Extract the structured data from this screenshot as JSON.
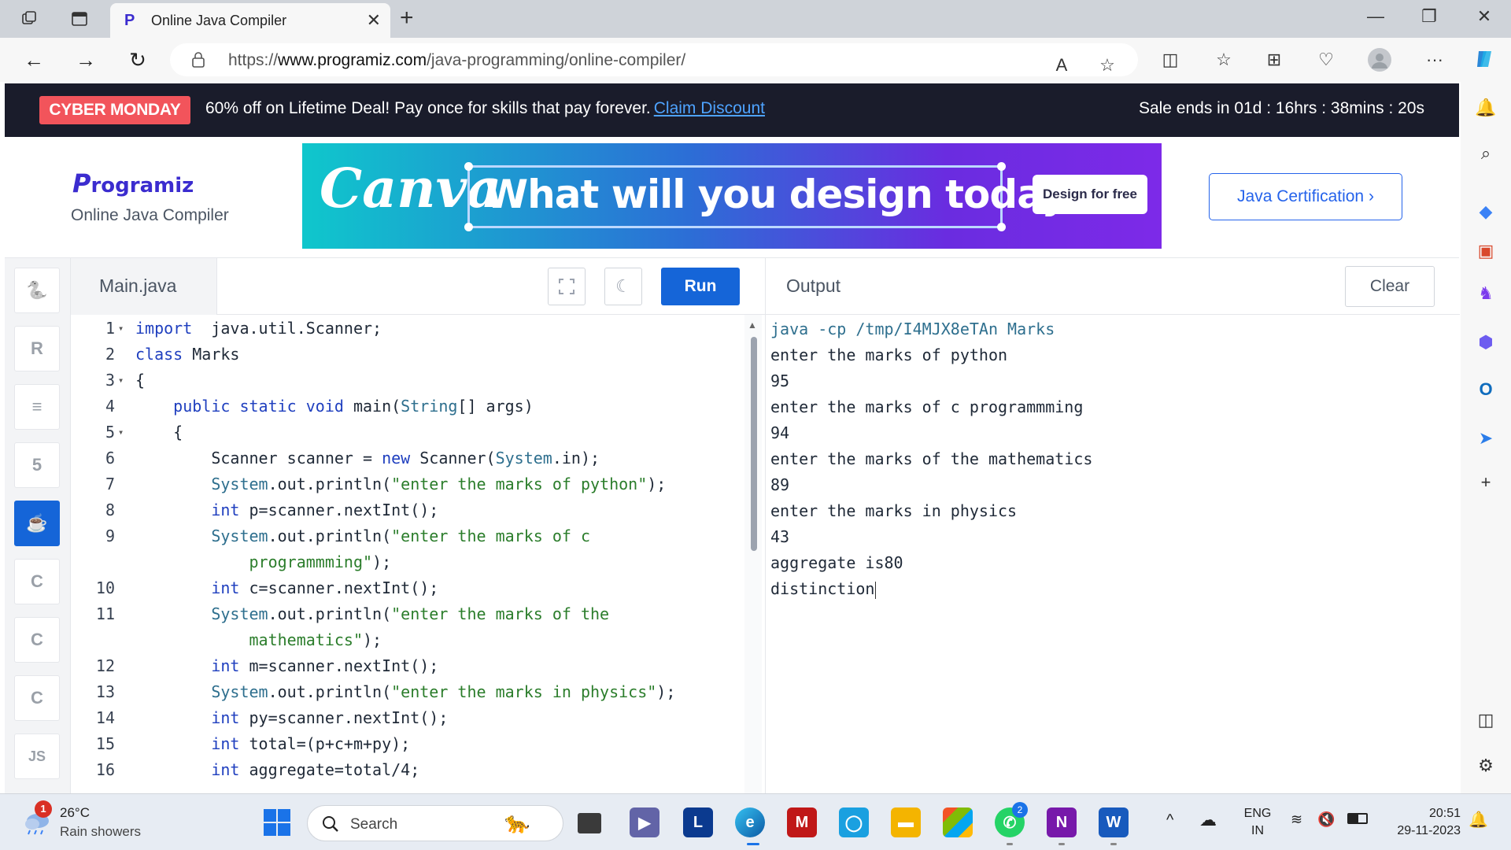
{
  "browser": {
    "tab_title": "Online Java Compiler",
    "url_prefix": "https://",
    "url_domain": "www.programiz.com",
    "url_path": "/java-programming/online-compiler/"
  },
  "promo": {
    "badge": "CYBER MONDAY",
    "text": "60% off on Lifetime Deal! Pay once for skills that pay forever.",
    "link": "Claim Discount",
    "timer": "Sale ends in 01d : 16hrs : 38mins : 20s"
  },
  "header": {
    "logo": "rogramiz",
    "logo_initial": "P",
    "subtitle": "Online Java Compiler",
    "ad_brand": "Canva",
    "ad_headline": "What will you design today?",
    "ad_cta": "Design for free",
    "cert_button": "Java Certification ›"
  },
  "languages": [
    {
      "name": "python",
      "glyph": "🐍"
    },
    {
      "name": "r",
      "glyph": "R"
    },
    {
      "name": "sql",
      "glyph": "≡"
    },
    {
      "name": "html",
      "glyph": "5"
    },
    {
      "name": "java",
      "glyph": "☕"
    },
    {
      "name": "c",
      "glyph": "C"
    },
    {
      "name": "cpp",
      "glyph": "C"
    },
    {
      "name": "csharp",
      "glyph": "C"
    },
    {
      "name": "js",
      "glyph": "JS"
    }
  ],
  "editor": {
    "file_name": "Main.java",
    "run_label": "Run",
    "lines": [
      {
        "n": "1",
        "fold": true,
        "tokens": [
          [
            "kw",
            "import"
          ],
          [
            "",
            "  java.util.Scanner;"
          ]
        ]
      },
      {
        "n": "2",
        "fold": false,
        "tokens": [
          [
            "kw",
            "class"
          ],
          [
            "",
            " Marks"
          ]
        ]
      },
      {
        "n": "3",
        "fold": true,
        "tokens": [
          [
            "",
            "{"
          ]
        ]
      },
      {
        "n": "4",
        "fold": false,
        "tokens": [
          [
            "",
            "    "
          ],
          [
            "kw",
            "public static void"
          ],
          [
            "",
            " main("
          ],
          [
            "cls",
            "String"
          ],
          [
            "",
            "[] args)"
          ]
        ]
      },
      {
        "n": "5",
        "fold": true,
        "tokens": [
          [
            "",
            "    {"
          ]
        ]
      },
      {
        "n": "6",
        "fold": false,
        "tokens": [
          [
            "",
            "        Scanner scanner = "
          ],
          [
            "kw",
            "new"
          ],
          [
            "",
            " Scanner("
          ],
          [
            "cls",
            "System"
          ],
          [
            "",
            ".in);"
          ]
        ]
      },
      {
        "n": "7",
        "fold": false,
        "tokens": [
          [
            "",
            "        "
          ],
          [
            "cls",
            "System"
          ],
          [
            "",
            ".out.println("
          ],
          [
            "str",
            "\"enter the marks of python\""
          ],
          [
            "",
            ");"
          ]
        ]
      },
      {
        "n": "8",
        "fold": false,
        "tokens": [
          [
            "",
            "        "
          ],
          [
            "kw",
            "int"
          ],
          [
            "",
            " p=scanner.nextInt();"
          ]
        ]
      },
      {
        "n": "9",
        "fold": false,
        "tokens": [
          [
            "",
            "        "
          ],
          [
            "cls",
            "System"
          ],
          [
            "",
            ".out.println("
          ],
          [
            "str",
            "\"enter the marks of c"
          ]
        ]
      },
      {
        "n": "",
        "fold": false,
        "tokens": [
          [
            "str",
            "            programmming\""
          ],
          [
            "",
            ");"
          ]
        ]
      },
      {
        "n": "10",
        "fold": false,
        "tokens": [
          [
            "",
            "        "
          ],
          [
            "kw",
            "int"
          ],
          [
            "",
            " c=scanner.nextInt();"
          ]
        ]
      },
      {
        "n": "11",
        "fold": false,
        "tokens": [
          [
            "",
            "        "
          ],
          [
            "cls",
            "System"
          ],
          [
            "",
            ".out.println("
          ],
          [
            "str",
            "\"enter the marks of the"
          ]
        ]
      },
      {
        "n": "",
        "fold": false,
        "tokens": [
          [
            "str",
            "            mathematics\""
          ],
          [
            "",
            ");"
          ]
        ]
      },
      {
        "n": "12",
        "fold": false,
        "tokens": [
          [
            "",
            "        "
          ],
          [
            "kw",
            "int"
          ],
          [
            "",
            " m=scanner.nextInt();"
          ]
        ]
      },
      {
        "n": "13",
        "fold": false,
        "tokens": [
          [
            "",
            "        "
          ],
          [
            "cls",
            "System"
          ],
          [
            "",
            ".out.println("
          ],
          [
            "str",
            "\"enter the marks in physics\""
          ],
          [
            "",
            ");"
          ]
        ]
      },
      {
        "n": "14",
        "fold": false,
        "tokens": [
          [
            "",
            "        "
          ],
          [
            "kw",
            "int"
          ],
          [
            "",
            " py=scanner.nextInt();"
          ]
        ]
      },
      {
        "n": "15",
        "fold": false,
        "tokens": [
          [
            "",
            "        "
          ],
          [
            "kw",
            "int"
          ],
          [
            "",
            " total=(p+c+m+py);"
          ]
        ]
      },
      {
        "n": "16",
        "fold": false,
        "tokens": [
          [
            "",
            "        "
          ],
          [
            "kw",
            "int"
          ],
          [
            "",
            " aggregate=total/4;"
          ]
        ]
      }
    ]
  },
  "output": {
    "title": "Output",
    "clear_label": "Clear",
    "command": "java -cp /tmp/I4MJX8eTAn Marks",
    "lines": [
      "enter the marks of python",
      "95",
      "enter the marks of c programmming",
      "94",
      "enter the marks of the mathematics",
      "89",
      "enter the marks in physics",
      "43",
      "aggregate is80",
      "distinction"
    ]
  },
  "taskbar": {
    "weather_badge": "1",
    "temperature": "26°C",
    "weather": "Rain showers",
    "search_placeholder": "Search",
    "whatsapp_badge": "2",
    "lang_1": "ENG",
    "lang_2": "IN",
    "time": "20:51",
    "date": "29-11-2023"
  }
}
